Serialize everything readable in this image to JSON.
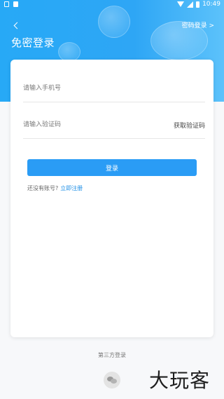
{
  "status_bar": {
    "time": "10:49"
  },
  "header": {
    "title": "免密登录",
    "password_login_link": "密码登录 >"
  },
  "form": {
    "phone_placeholder": "请输入手机号",
    "code_placeholder": "请输入验证码",
    "get_code_label": "获取验证码",
    "login_button": "登录",
    "no_account_text": "还没有账号?",
    "register_link": "立即注册"
  },
  "third_party": {
    "label": "第三方登录",
    "icons": [
      "wechat-icon"
    ]
  },
  "watermark": {
    "text": "大玩客"
  },
  "colors": {
    "primary": "#2a9cf5",
    "header_gradient_start": "#27a9f6",
    "link": "#1e8fe6"
  }
}
